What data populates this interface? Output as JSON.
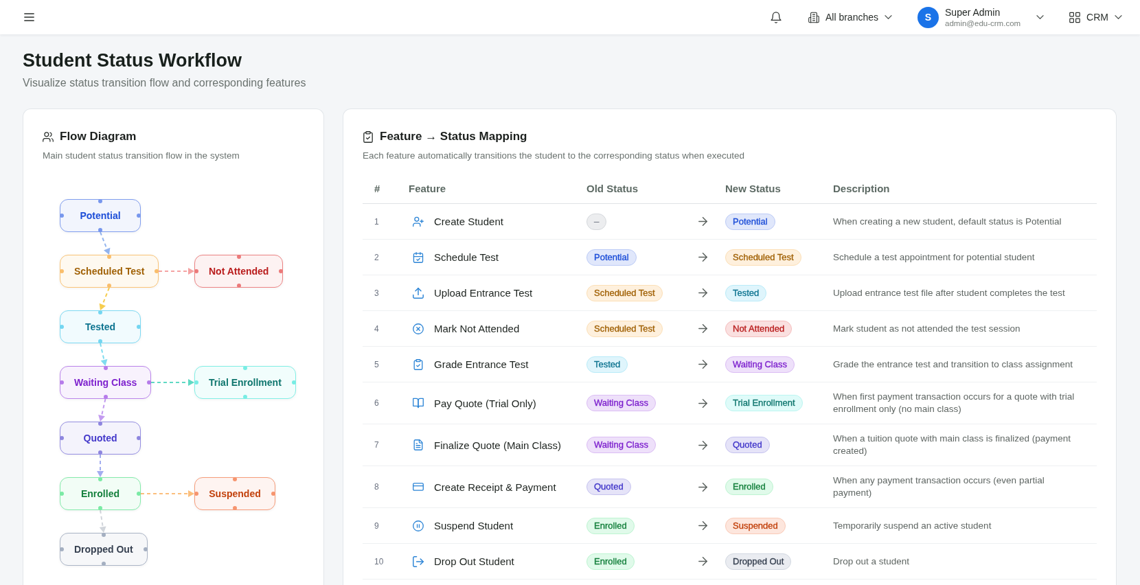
{
  "topbar": {
    "branch_selector": {
      "label": "All branches"
    },
    "user": {
      "initial": "S",
      "name": "Super Admin",
      "email": "admin@edu-crm.com"
    },
    "app_switcher": {
      "label": "CRM"
    }
  },
  "page": {
    "title": "Student Status Workflow",
    "subtitle": "Visualize status transition flow and corresponding features"
  },
  "flow_diagram": {
    "title": "Flow Diagram",
    "description": "Main student status transition flow in the system",
    "stages": [
      {
        "label": "Potential",
        "color": "#1d4ed8"
      },
      {
        "label": "Scheduled Test",
        "color": "#a16207",
        "edge": {
          "color": "#93b4ee"
        },
        "branch": {
          "label": "Not Attended",
          "color": "#b91c1c",
          "edge": {
            "color": "#f4a3a3"
          }
        }
      },
      {
        "label": "Tested",
        "color": "#0e7490",
        "edge": {
          "color": "#f6cd4f"
        }
      },
      {
        "label": "Waiting Class",
        "color": "#7e22ce",
        "edge": {
          "color": "#7fdcef"
        },
        "branch": {
          "label": "Trial Enrollment",
          "color": "#0f766e",
          "edge": {
            "color": "#5fd9c3"
          }
        }
      },
      {
        "label": "Quoted",
        "color": "#4338ca",
        "edge": {
          "color": "#c39bf0"
        }
      },
      {
        "label": "Enrolled",
        "color": "#15803d",
        "edge": {
          "color": "#a3adf0"
        },
        "branch": {
          "label": "Suspended",
          "color": "#c2410c",
          "edge": {
            "color": "#fbbf7d"
          }
        }
      },
      {
        "label": "Dropped Out",
        "color": "#374151",
        "edge": {
          "color": "#d1d5db"
        }
      }
    ]
  },
  "mapping": {
    "title": "Feature → Status Mapping",
    "description": "Each feature automatically transitions the student to the corresponding status when executed",
    "columns": [
      "#",
      "Feature",
      "Old Status",
      "New Status",
      "Description"
    ],
    "rows": [
      {
        "number": "1",
        "feature": "Create Student",
        "old_status": {
          "label": "–",
          "color": "#6b7280"
        },
        "new_status": {
          "label": "Potential",
          "color": "#1d4ed8"
        },
        "description": "When creating a new student, default status is Potential"
      },
      {
        "number": "2",
        "feature": "Schedule Test",
        "old_status": {
          "label": "Potential",
          "color": "#1d4ed8"
        },
        "new_status": {
          "label": "Scheduled Test",
          "color": "#a16207"
        },
        "description": "Schedule a test appointment for potential student"
      },
      {
        "number": "3",
        "feature": "Upload Entrance Test",
        "old_status": {
          "label": "Scheduled Test",
          "color": "#a16207"
        },
        "new_status": {
          "label": "Tested",
          "color": "#0e7490"
        },
        "description": "Upload entrance test file after student completes the test"
      },
      {
        "number": "4",
        "feature": "Mark Not Attended",
        "old_status": {
          "label": "Scheduled Test",
          "color": "#a16207"
        },
        "new_status": {
          "label": "Not Attended",
          "color": "#b91c1c"
        },
        "description": "Mark student as not attended the test session"
      },
      {
        "number": "5",
        "feature": "Grade Entrance Test",
        "old_status": {
          "label": "Tested",
          "color": "#0e7490"
        },
        "new_status": {
          "label": "Waiting Class",
          "color": "#7e22ce"
        },
        "description": "Grade the entrance test and transition to class assignment"
      },
      {
        "number": "6",
        "feature": "Pay Quote (Trial Only)",
        "old_status": {
          "label": "Waiting Class",
          "color": "#7e22ce"
        },
        "new_status": {
          "label": "Trial Enrollment",
          "color": "#0f766e"
        },
        "description": "When first payment transaction occurs for a quote with trial enrollment only (no main class)"
      },
      {
        "number": "7",
        "feature": "Finalize Quote (Main Class)",
        "old_status": {
          "label": "Waiting Class",
          "color": "#7e22ce"
        },
        "new_status": {
          "label": "Quoted",
          "color": "#4338ca"
        },
        "description": "When a tuition quote with main class is finalized (payment created)"
      },
      {
        "number": "8",
        "feature": "Create Receipt & Payment",
        "old_status": {
          "label": "Quoted",
          "color": "#4338ca"
        },
        "new_status": {
          "label": "Enrolled",
          "color": "#15803d"
        },
        "description": "When any payment transaction occurs (even partial payment)"
      },
      {
        "number": "9",
        "feature": "Suspend Student",
        "old_status": {
          "label": "Enrolled",
          "color": "#15803d"
        },
        "new_status": {
          "label": "Suspended",
          "color": "#c2410c"
        },
        "description": "Temporarily suspend an active student"
      },
      {
        "number": "10",
        "feature": "Drop Out Student",
        "old_status": {
          "label": "Enrolled",
          "color": "#15803d"
        },
        "new_status": {
          "label": "Dropped Out",
          "color": "#374151"
        },
        "description": "Drop out a student"
      }
    ]
  }
}
